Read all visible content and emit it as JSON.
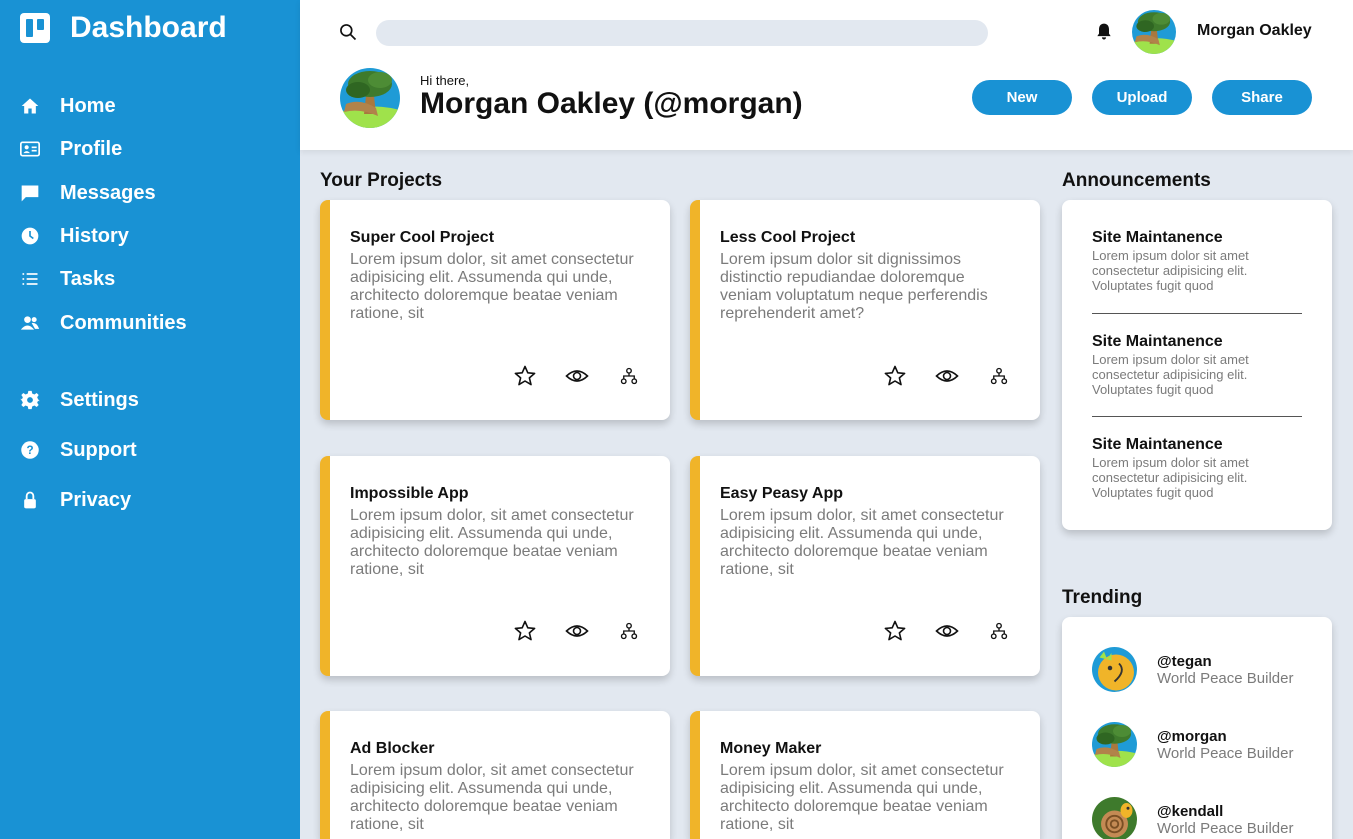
{
  "brand": {
    "title": "Dashboard"
  },
  "nav": {
    "primary": [
      {
        "label": "Home",
        "icon": "home-icon"
      },
      {
        "label": "Profile",
        "icon": "id-card-icon"
      },
      {
        "label": "Messages",
        "icon": "message-icon"
      },
      {
        "label": "History",
        "icon": "clock-icon"
      },
      {
        "label": "Tasks",
        "icon": "list-icon"
      },
      {
        "label": "Communities",
        "icon": "people-icon"
      }
    ],
    "secondary": [
      {
        "label": "Settings",
        "icon": "gear-icon"
      },
      {
        "label": "Support",
        "icon": "help-icon"
      },
      {
        "label": "Privacy",
        "icon": "lock-icon"
      }
    ]
  },
  "header": {
    "search": {
      "value": "",
      "placeholder": ""
    },
    "user_name": "Morgan Oakley",
    "greeting": "Hi there,",
    "full_name": "Morgan Oakley (@morgan)",
    "buttons": {
      "new": "New",
      "upload": "Upload",
      "share": "Share"
    }
  },
  "projects": {
    "title": "Your Projects",
    "items": [
      {
        "title": "Super Cool Project",
        "desc": "Lorem ipsum dolor, sit amet consectetur adipisicing elit. Assumenda qui unde, architecto doloremque beatae veniam ratione, sit"
      },
      {
        "title": "Less Cool Project",
        "desc": "Lorem ipsum dolor sit dignissimos distinctio repudiandae doloremque veniam voluptatum neque perferendis reprehenderit amet?"
      },
      {
        "title": "Impossible App",
        "desc": "Lorem ipsum dolor, sit amet consectetur adipisicing elit. Assumenda qui unde, architecto doloremque beatae veniam ratione, sit"
      },
      {
        "title": "Easy Peasy App",
        "desc": "Lorem ipsum dolor, sit amet consectetur adipisicing elit. Assumenda qui unde, architecto doloremque beatae veniam ratione, sit"
      },
      {
        "title": "Ad Blocker",
        "desc": "Lorem ipsum dolor, sit amet consectetur adipisicing elit. Assumenda qui unde, architecto doloremque beatae veniam ratione, sit"
      },
      {
        "title": "Money Maker",
        "desc": "Lorem ipsum dolor, sit amet consectetur adipisicing elit. Assumenda qui unde, architecto doloremque beatae veniam ratione, sit"
      }
    ]
  },
  "announcements": {
    "title": "Announcements",
    "items": [
      {
        "title": "Site Maintanence",
        "text": "Lorem ipsum dolor sit amet consectetur adipisicing elit. Voluptates fugit quod"
      },
      {
        "title": "Site Maintanence",
        "text": "Lorem ipsum dolor sit amet consectetur adipisicing elit. Voluptates fugit quod"
      },
      {
        "title": "Site Maintanence",
        "text": "Lorem ipsum dolor sit amet consectetur adipisicing elit. Voluptates fugit quod"
      }
    ]
  },
  "trending": {
    "title": "Trending",
    "items": [
      {
        "handle": "@tegan",
        "role": "World Peace Builder"
      },
      {
        "handle": "@morgan",
        "role": "World Peace Builder"
      },
      {
        "handle": "@kendall",
        "role": "World Peace Builder"
      }
    ]
  },
  "colors": {
    "sidebar": "#1992d4",
    "accent": "#f0b429",
    "background": "#e2e8f0",
    "muted_text": "#7b7b7b"
  }
}
